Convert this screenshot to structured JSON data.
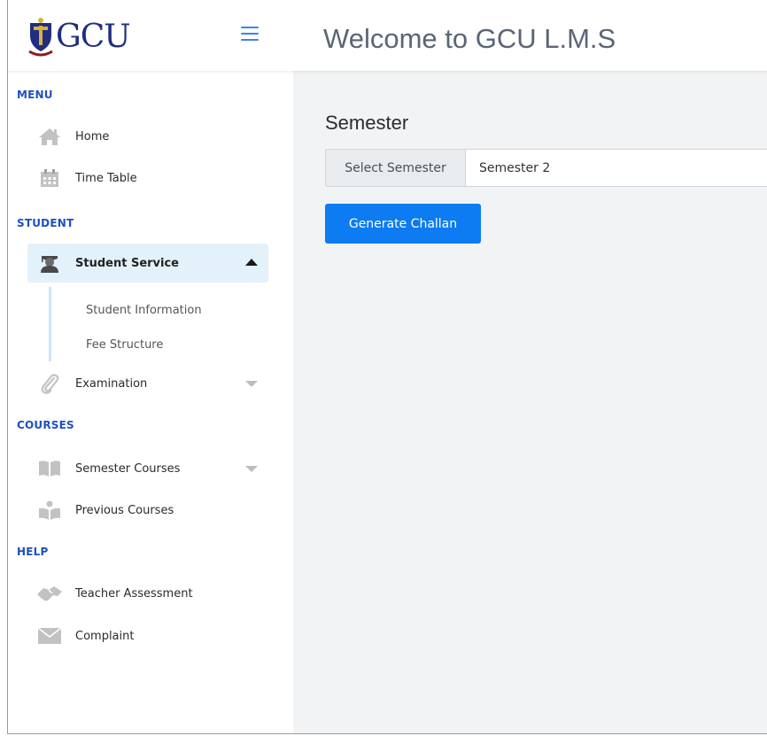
{
  "header": {
    "logo_text": "GCU",
    "title": "Welcome to GCU L.M.S"
  },
  "sidebar": {
    "sections": {
      "menu": "MENU",
      "student": "STUDENT",
      "courses": "COURSES",
      "help": "HELP"
    },
    "items": {
      "home": "Home",
      "time_table": "Time Table",
      "student_service": "Student Service",
      "student_information": "Student Information",
      "fee_structure": "Fee Structure",
      "examination": "Examination",
      "semester_courses": "Semester Courses",
      "previous_courses": "Previous Courses",
      "teacher_assessment": "Teacher Assessment",
      "complaint": "Complaint"
    },
    "icons": {
      "home": "home-icon",
      "time_table": "calendar-icon",
      "student_service": "graduate-icon",
      "examination": "paperclip-icon",
      "semester_courses": "book-icon",
      "previous_courses": "reader-icon",
      "teacher_assessment": "handshake-icon",
      "complaint": "envelope-icon"
    }
  },
  "main": {
    "heading": "Semester",
    "select_label": "Select Semester",
    "select_value": "Semester 2",
    "generate_button": "Generate Challan"
  },
  "colors": {
    "accent": "#0d7bf2",
    "section_heading": "#1f4fbf",
    "active_item_bg": "#e3f1fb",
    "main_bg": "#f2f3f5",
    "icon_gray": "#c2c2c2"
  }
}
